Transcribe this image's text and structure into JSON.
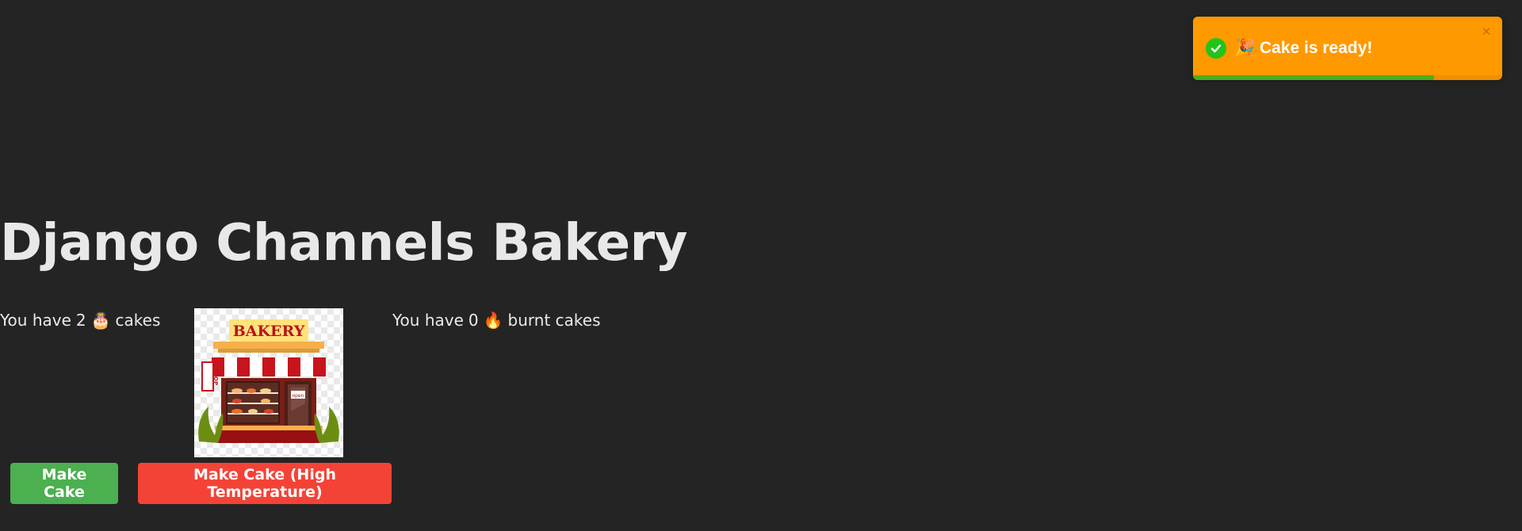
{
  "toast": {
    "message": "🎉 Cake is ready!",
    "close_symbol": "×",
    "progress_fraction": 0.78,
    "color": "#ff9900",
    "icon": "check-circle-icon"
  },
  "page": {
    "title": "Django Channels Bakery"
  },
  "counters": {
    "cakes": {
      "prefix": "You have",
      "count": "2",
      "emoji": "🎂",
      "suffix": "cakes"
    },
    "burnt": {
      "prefix": "You have",
      "count": "0",
      "emoji": "🔥",
      "suffix": "burnt cakes"
    }
  },
  "image": {
    "sign_text": "BAKERY",
    "side_sign": "SHOP",
    "door_sign": "open"
  },
  "buttons": {
    "make_cake": "Make Cake",
    "make_cake_high": "Make Cake (High Temperature)"
  },
  "colors": {
    "background": "#242424",
    "make_cake_button": "#4caf50",
    "high_temp_button": "#f44336",
    "toast_progress": "#4caf1a"
  }
}
